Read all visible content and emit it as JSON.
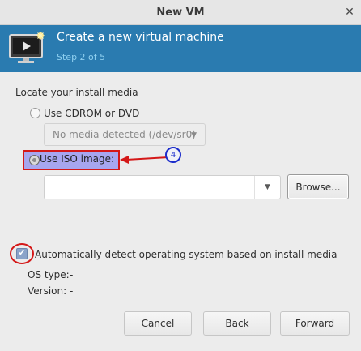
{
  "window": {
    "title": "New VM",
    "close_glyph": "✕"
  },
  "banner": {
    "heading": "Create a new virtual machine",
    "step": "Step 2 of 5",
    "icon": "vm-monitor-icon"
  },
  "media": {
    "section_label": "Locate your install media",
    "cdrom_label": "Use CDROM or DVD",
    "cdrom_combo_value": "No media detected (/dev/sr0)",
    "iso_label": "Use ISO image:",
    "iso_path_value": "",
    "browse_label": "Browse...",
    "selected": "iso"
  },
  "annotation": {
    "badge_number": "4",
    "arrow_color": "#d41818",
    "badge_color": "#1b2ccb"
  },
  "detect": {
    "auto_label": "Automatically detect operating system based on install media",
    "checked": true,
    "os_type_label": "OS type:",
    "os_type_value": "-",
    "version_label": "Version:",
    "version_value": "-"
  },
  "buttons": {
    "cancel": "Cancel",
    "back": "Back",
    "forward": "Forward"
  },
  "colors": {
    "banner_bg": "#2a7bb0",
    "step_text": "#8fd0f0",
    "highlight_fill": "#a7a6ef",
    "highlight_border": "#d41818"
  }
}
